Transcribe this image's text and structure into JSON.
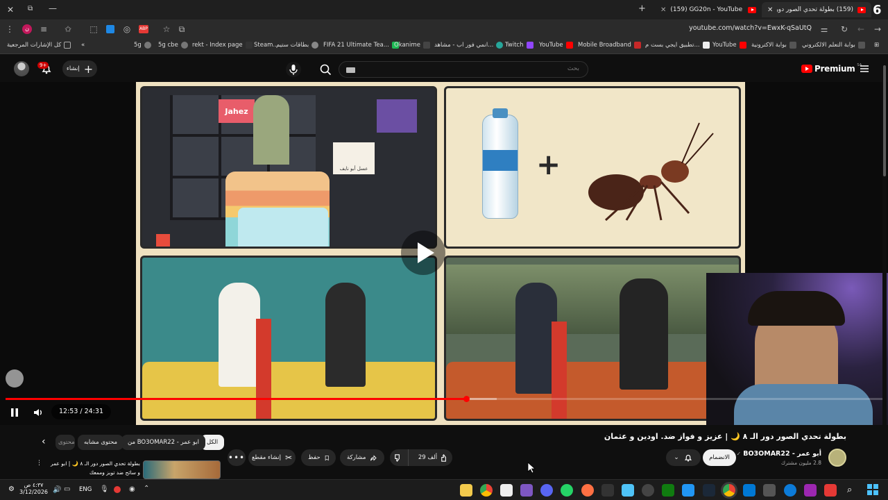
{
  "browser": {
    "tabs": [
      {
        "title": "(159) بطولة تحدي الصور دور الـ"
      },
      {
        "title": "(159) GG20n - YouTube"
      }
    ],
    "tab_count_badge": "6",
    "url": "youtube.com/watch?v=EwxK-qSaUtQ"
  },
  "bookmarks": [
    "كل الإشارات المرجعية",
    "5g",
    "5g cbe",
    "rekt - Index page",
    "Steam...",
    "بطاقات ستيم",
    "FIFA 21 Ultimate Tea...",
    "Okanime",
    "انمي فور اب - مشاهد...",
    "Twitch",
    "YouTube",
    "Mobile Broadband",
    "تطبيق ايجي بست م...",
    "YouTube",
    "بوابة الاكترونية",
    "بوابة التعلم الالكتروني"
  ],
  "masthead": {
    "notification_badge": "9+",
    "create_label": "إنشاء",
    "search_placeholder": "بحث",
    "logo_label": "Premium",
    "logo_region": "SA"
  },
  "player": {
    "time": "12:53 / 24:31",
    "progress": 0.525,
    "buffered": 0.56,
    "panel_tl_texts": {
      "logo1": "Jahez",
      "logo2": "عسل أبو نايف"
    }
  },
  "video": {
    "title": "بطولة تحدي الصور دور الـ ٨ 🌙 | عزيز و فواز ضد. اودين و عثمان",
    "channel_name": "BO3OMAR22 - أبو عمر",
    "subscribers": "2.8 مليون مشترك",
    "join_label": "الانضمام",
    "likes": "29 ألف",
    "share_label": "مشاركة",
    "save_label": "حفظ",
    "clip_label": "إنشاء مقطع",
    "chips": [
      "الكل",
      "من BO3OMAR22 - ابو عمر",
      "محتوى مشابه",
      "محتوى"
    ],
    "up_next_title": "بطولة تحدي الصور دور الـ ٨ 🌙 | ابو عمر",
    "up_next_sub": "و سائح ضد توبز وممعك"
  },
  "taskbar": {
    "time": "٤:٣٧ ص",
    "date": "3/12/2026",
    "lang": "ENG"
  },
  "colors": {
    "accent": "#ff0000",
    "panel_bg": "#efe1c0"
  }
}
